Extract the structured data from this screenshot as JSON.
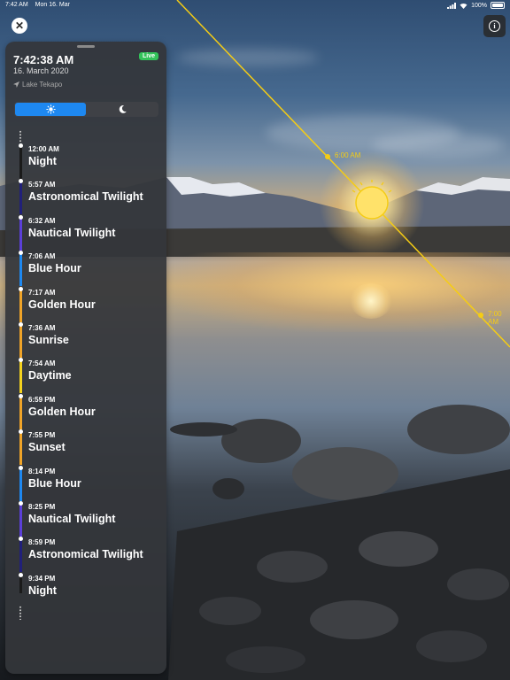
{
  "status_bar": {
    "time": "7:42 AM",
    "date": "Mon 16. Mar",
    "battery": "100%"
  },
  "icons": {
    "close": "close-icon",
    "info": "info-icon",
    "location": "location-arrow-icon",
    "sun": "sun-icon",
    "moon": "moon-icon"
  },
  "sun_path": {
    "labels": [
      "6:00 AM",
      "7:00 AM"
    ],
    "color": "#f5cc14"
  },
  "panel": {
    "current_time": "7:42:38 AM",
    "current_date": "16. March 2020",
    "location": "Lake Tekapo",
    "live_badge": "Live",
    "mode_selected": "sun",
    "phases": [
      {
        "time": "12:00 AM",
        "name": "Night",
        "color": "#1a1a1a"
      },
      {
        "time": "5:57 AM",
        "name": "Astronomical Twilight",
        "color": "#21207a"
      },
      {
        "time": "6:32 AM",
        "name": "Nautical Twilight",
        "color": "#5b3fd8"
      },
      {
        "time": "7:06 AM",
        "name": "Blue Hour",
        "color": "#1e88f0"
      },
      {
        "time": "7:17 AM",
        "name": "Golden Hour",
        "color": "#f0a428"
      },
      {
        "time": "7:36 AM",
        "name": "Sunrise",
        "color": "#f0a428"
      },
      {
        "time": "7:54 AM",
        "name": "Daytime",
        "color": "#f5d21e"
      },
      {
        "time": "6:59 PM",
        "name": "Golden Hour",
        "color": "#f0a428"
      },
      {
        "time": "7:55 PM",
        "name": "Sunset",
        "color": "#f0a428"
      },
      {
        "time": "8:14 PM",
        "name": "Blue Hour",
        "color": "#1e88f0"
      },
      {
        "time": "8:25 PM",
        "name": "Nautical Twilight",
        "color": "#5b3fd8"
      },
      {
        "time": "8:59 PM",
        "name": "Astronomical Twilight",
        "color": "#21207a"
      },
      {
        "time": "9:34 PM",
        "name": "Night",
        "color": "#1a1a1a"
      }
    ]
  }
}
